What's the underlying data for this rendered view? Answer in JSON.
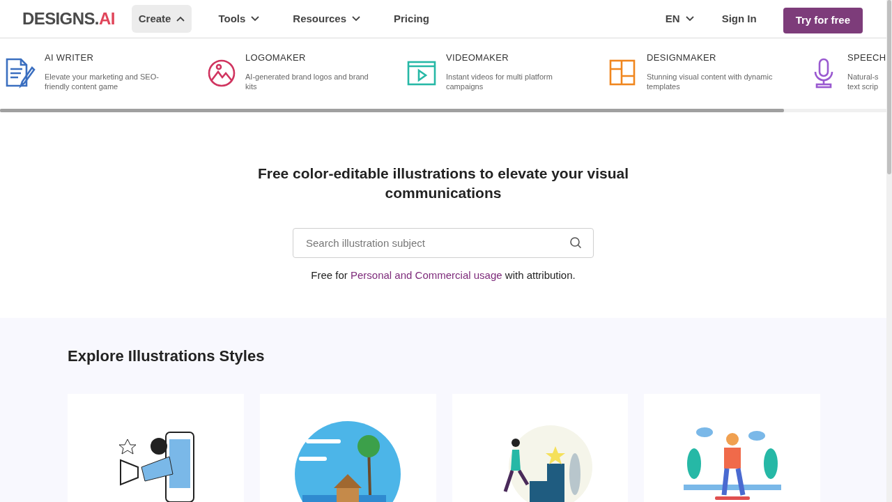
{
  "header": {
    "logo": {
      "text": "DESIGNS.",
      "accent": "AI"
    },
    "nav": [
      {
        "label": "Create",
        "kind": "dropdown",
        "expanded": true
      },
      {
        "label": "Tools",
        "kind": "dropdown",
        "expanded": false
      },
      {
        "label": "Resources",
        "kind": "dropdown",
        "expanded": false
      },
      {
        "label": "Pricing",
        "kind": "link"
      }
    ],
    "language": "EN",
    "sign_in": "Sign In",
    "cta": "Try for free"
  },
  "products": [
    {
      "name": "AI WRITER",
      "description": "Elevate your marketing and SEO-friendly content game",
      "color": "#3b6fc0",
      "kind": "writer"
    },
    {
      "name": "LOGOMAKER",
      "description": "AI-generated brand logos and brand kits",
      "color": "#d0345f",
      "kind": "logo"
    },
    {
      "name": "VIDEOMAKER",
      "description": "Instant videos for multi platform campaigns",
      "color": "#26b8a6",
      "kind": "video"
    },
    {
      "name": "DESIGNMAKER",
      "description": "Stunning visual content with dynamic templates",
      "color": "#f0861e",
      "kind": "design"
    },
    {
      "name": "SPEECH",
      "description": "Natural-s text scrip",
      "color": "#9a5ad0",
      "kind": "mic"
    }
  ],
  "hero": {
    "title": "Free color-editable illustrations to elevate your visual communications",
    "search": {
      "placeholder": "Search illustration subject"
    },
    "note": {
      "before": "Free for ",
      "link": "Personal and Commercial usage",
      "after": " with attribution."
    }
  },
  "styles": {
    "title": "Explore Illustrations Styles"
  }
}
